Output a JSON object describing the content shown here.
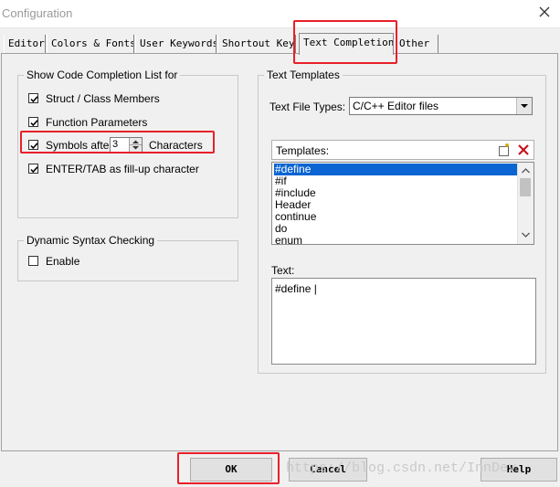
{
  "window": {
    "title": "Configuration"
  },
  "tabs": [
    {
      "label": "Editor"
    },
    {
      "label": "Colors & Fonts"
    },
    {
      "label": "User Keywords"
    },
    {
      "label": "Shortout Keys"
    },
    {
      "label": "Text Completion"
    },
    {
      "label": "Other"
    }
  ],
  "completion": {
    "group_title": "Show Code Completion List for",
    "struct_members": {
      "label": "Struct / Class Members",
      "checked": true
    },
    "function_params": {
      "label": "Function Parameters",
      "checked": true
    },
    "symbols": {
      "label": "Symbols after",
      "value": "3",
      "suffix": "Characters",
      "checked": true
    },
    "enter_tab": {
      "label": "ENTER/TAB as fill-up character",
      "checked": true
    }
  },
  "syntax": {
    "group_title": "Dynamic Syntax Checking",
    "enable": {
      "label": "Enable",
      "checked": false
    }
  },
  "templates": {
    "group_title": "Text Templates",
    "file_types_label": "Text File Types:",
    "file_types_value": "C/C++ Editor files",
    "list_label": "Templates:",
    "items": [
      "#define",
      "#if",
      "#include",
      "Header",
      "continue",
      "do",
      "enum"
    ],
    "selected_index": 0,
    "text_label": "Text:",
    "text_value": "#define |"
  },
  "buttons": {
    "ok": "OK",
    "cancel": "Cancel",
    "help": "Help"
  },
  "watermark": "https://blog.csdn.net/InnDev",
  "colors": {
    "highlight": "#e8202a",
    "selection": "#0a64d2"
  }
}
